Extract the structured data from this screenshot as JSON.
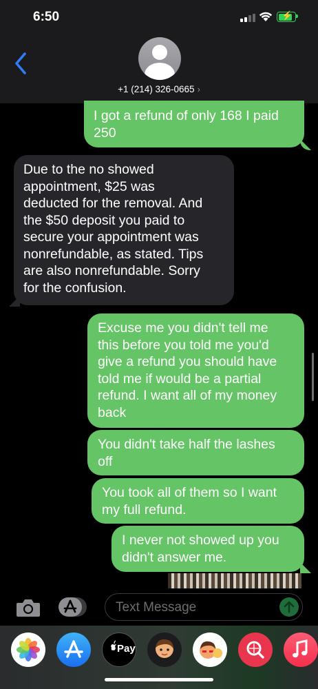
{
  "status_bar": {
    "time": "6:50"
  },
  "header": {
    "contact": "+1 (214) 326-0665",
    "chevron": "›"
  },
  "messages": [
    {
      "dir": "out",
      "lines": [
        "I got a refund of only 168 I paid",
        "250"
      ]
    },
    {
      "dir": "in",
      "lines": [
        "Due to the no showed",
        "appointment,  $25 was",
        "deducted for the removal. And",
        "the $50 deposit you paid to",
        "secure your appointment was",
        "nonrefundable, as stated. Tips",
        "are also nonrefundable. Sorry",
        "for the confusion."
      ]
    },
    {
      "dir": "out",
      "lines": [
        "Excuse me you didn't tell me",
        "this before you told me you'd",
        "give a refund you should have",
        "told me if would be a partial",
        "refund. I want all of my money",
        "back"
      ]
    },
    {
      "dir": "out",
      "lines": [
        "You didn't take half the lashes",
        "off"
      ]
    },
    {
      "dir": "out",
      "lines": [
        "You took all of them so I want",
        "my full refund."
      ]
    },
    {
      "dir": "out",
      "lines": [
        "I never not showed up you",
        "didn't answer me."
      ]
    }
  ],
  "compose": {
    "placeholder": "Text Message"
  },
  "app_strip": {
    "apps": [
      "photos-icon",
      "app-store-icon",
      "apple-pay-icon",
      "memoji-icon",
      "memoji-stickers-icon",
      "search-images-icon",
      "music-icon"
    ],
    "apple_pay_label": "Pay"
  },
  "colors": {
    "outgoing": "#65c466",
    "incoming": "#26252a",
    "link": "#2f7cf6"
  }
}
